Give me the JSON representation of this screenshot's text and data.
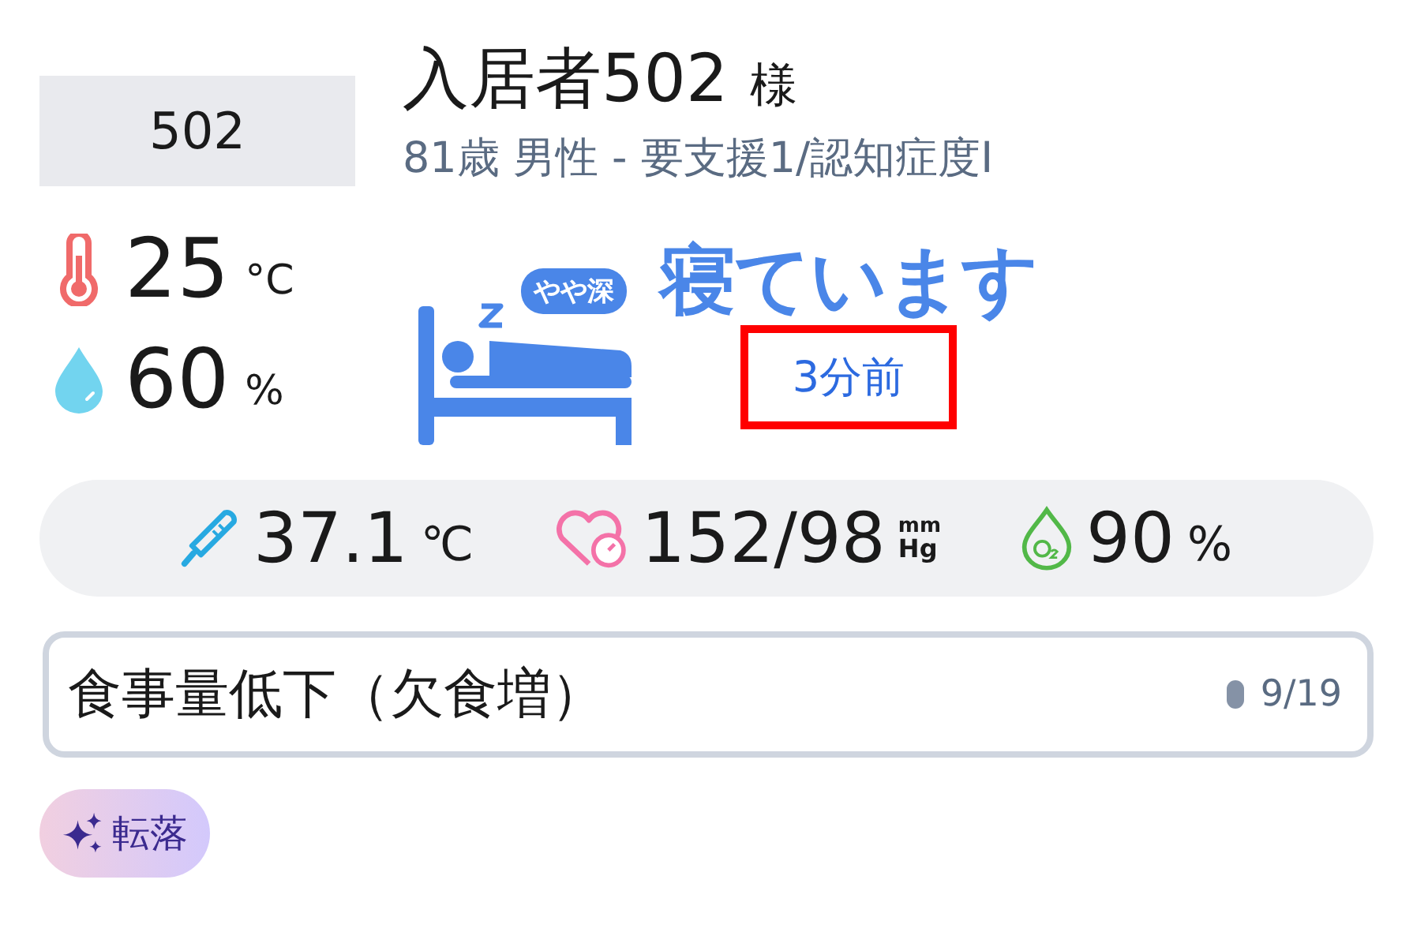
{
  "room": {
    "number": "502"
  },
  "resident": {
    "name": "入居者502",
    "honorific": "様",
    "details": "81歳 男性 - 要支援1/認知症度I"
  },
  "environment": [
    {
      "kind": "temperature",
      "value": "25",
      "unit": "°C"
    },
    {
      "kind": "humidity",
      "value": "60",
      "unit": "%"
    }
  ],
  "sleep": {
    "depth_badge": "やや深",
    "status": "寝ています",
    "time": "3分前",
    "highlighted": true
  },
  "vitals": [
    {
      "kind": "body_temperature",
      "value": "37.1",
      "unit": "℃"
    },
    {
      "kind": "blood_pressure",
      "value": "152/98",
      "unit_top": "mm",
      "unit_bottom": "Hg"
    },
    {
      "kind": "spo2",
      "value": "90",
      "unit": "%"
    }
  ],
  "note": {
    "text": "食事量低下（欠食増）",
    "date": "9/19"
  },
  "tags": [
    {
      "label": "転落"
    }
  ]
}
